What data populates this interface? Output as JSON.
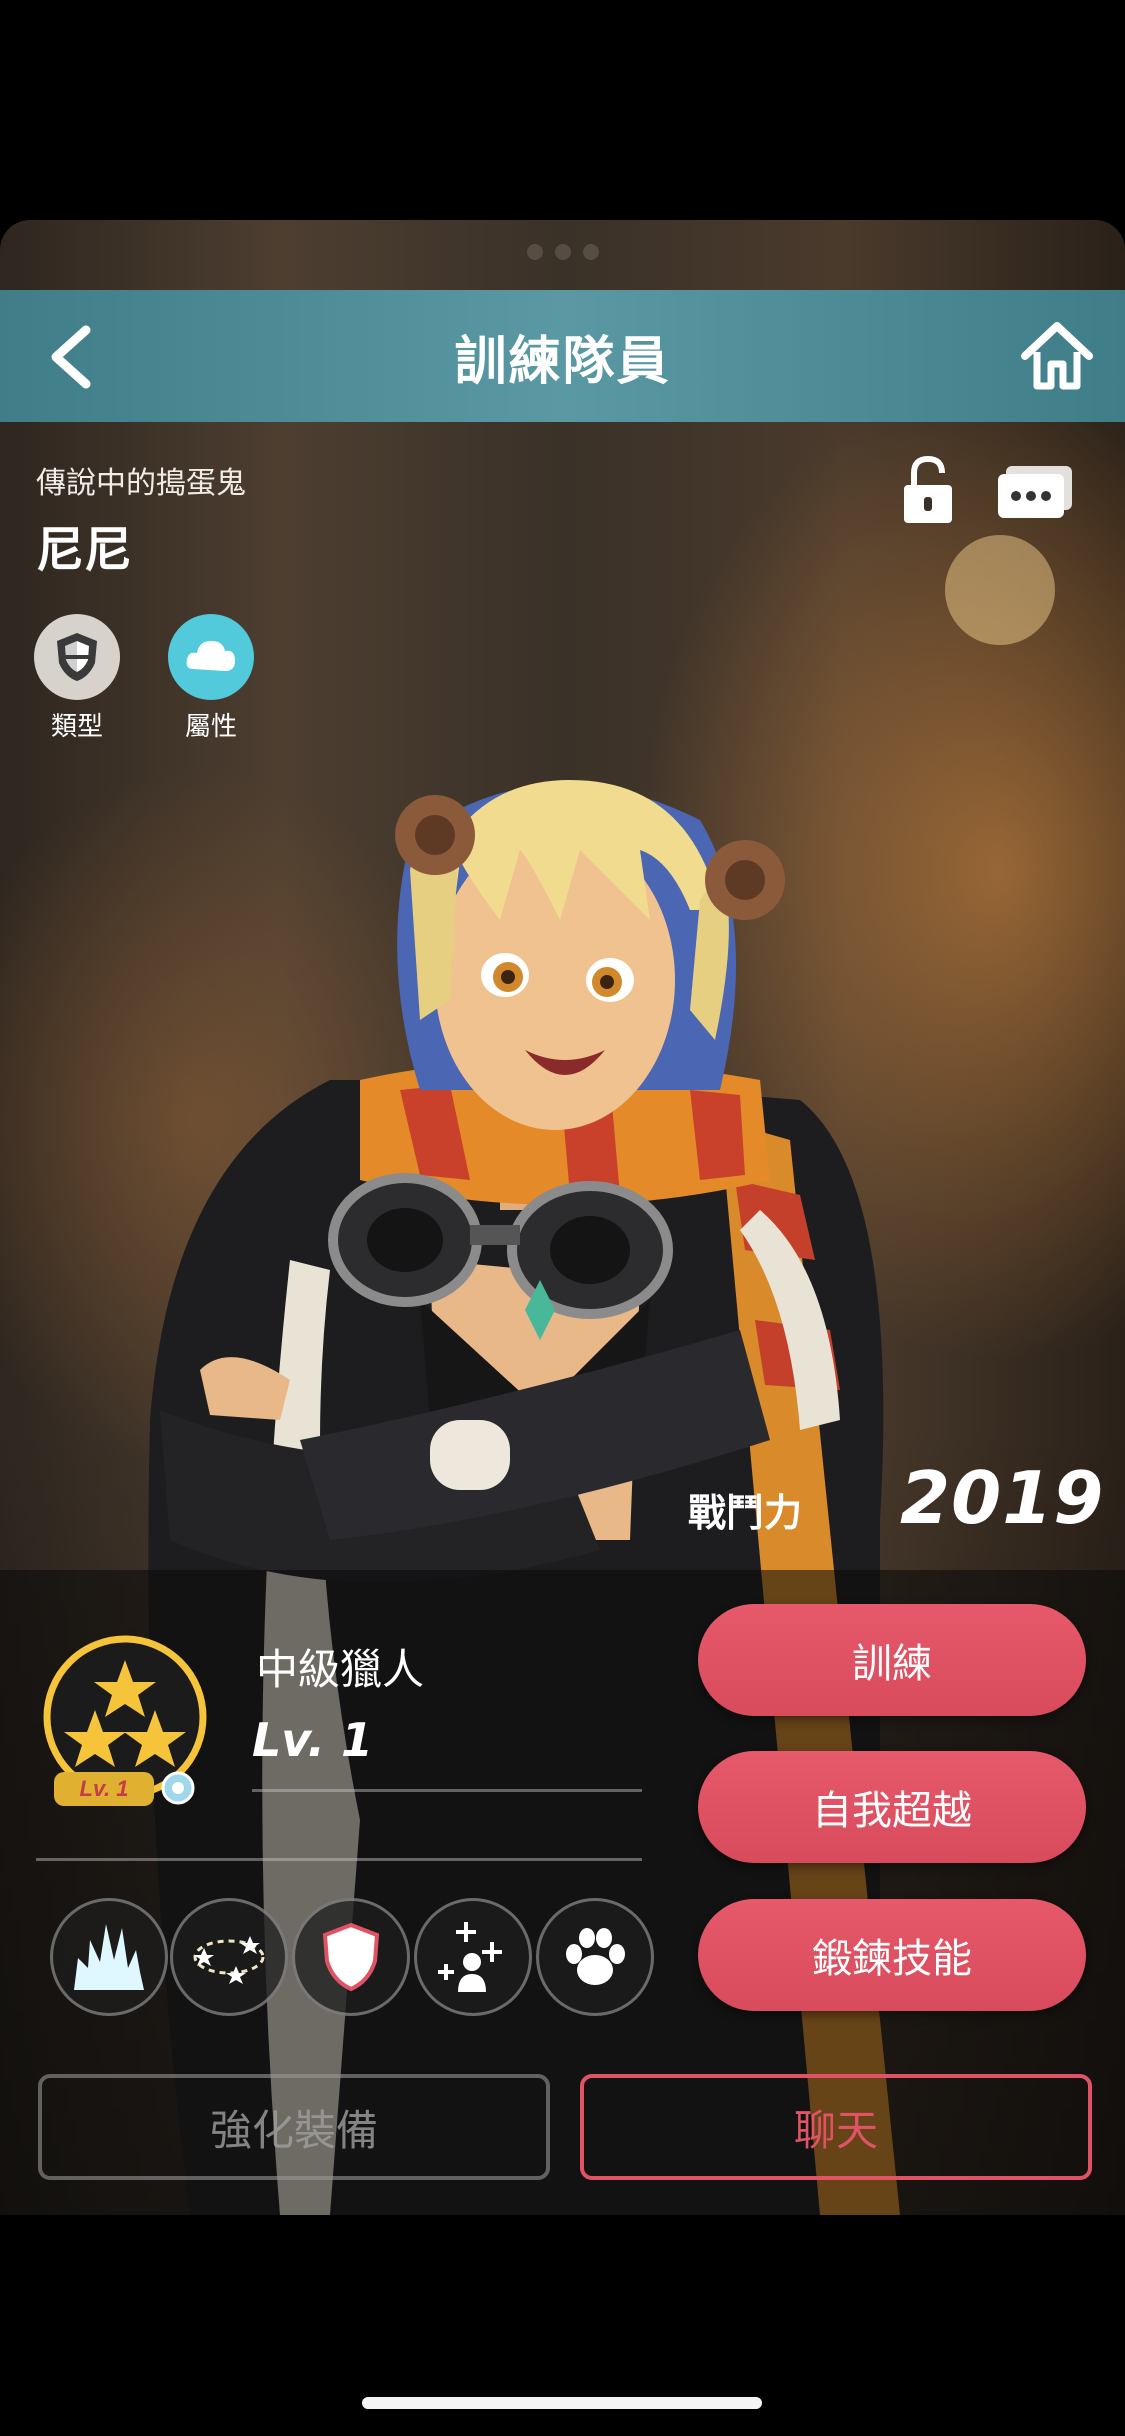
{
  "header": {
    "title": "訓練隊員"
  },
  "character": {
    "subtitle": "傳說中的搗蛋鬼",
    "name": "尼尼"
  },
  "badges": [
    {
      "label": "類型",
      "icon": "shield-icon"
    },
    {
      "label": "屬性",
      "icon": "element-cloud-icon"
    }
  ],
  "combat_power": {
    "label": "戰鬥力",
    "value": "2019"
  },
  "rank": {
    "title": "中級獵人",
    "level": "Lv. 1",
    "badge_level": "Lv. 1",
    "stars": 3
  },
  "skills": [
    {
      "icon": "burst-skill-icon"
    },
    {
      "icon": "stars-orbit-skill-icon"
    },
    {
      "icon": "shield-skill-icon"
    },
    {
      "icon": "buff-person-skill-icon"
    },
    {
      "icon": "paw-skill-icon"
    }
  ],
  "actions": {
    "train": "訓練",
    "transcend": "自我超越",
    "skill_training": "鍛鍊技能",
    "enhance_equipment": "強化裝備",
    "chat": "聊天"
  },
  "colors": {
    "header_bg": "#4f8e99",
    "accent_red": "#e05364",
    "gold": "#f5c43a"
  }
}
